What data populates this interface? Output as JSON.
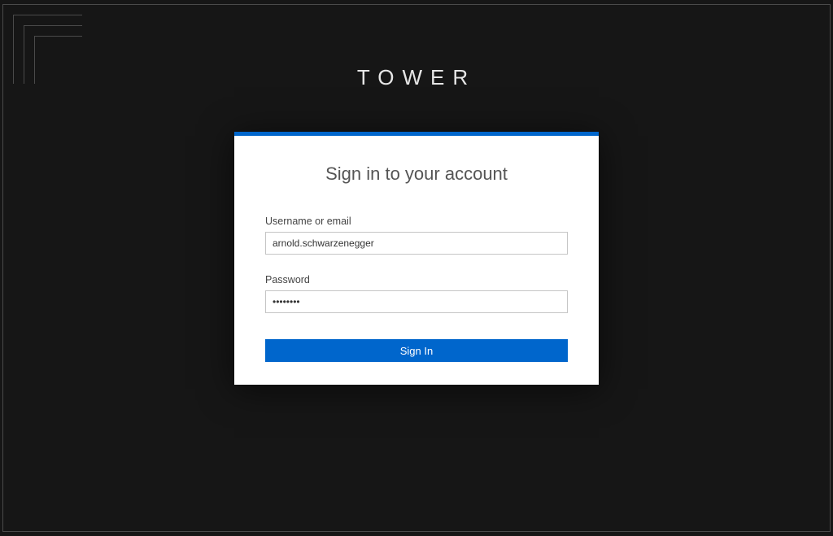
{
  "brand": {
    "title": "TOWER"
  },
  "login": {
    "title": "Sign in to your account",
    "username_label": "Username or email",
    "username_value": "arnold.schwarzenegger",
    "password_label": "Password",
    "password_value": "••••••••",
    "button_label": "Sign In"
  },
  "colors": {
    "background": "#161616",
    "accent": "#0066cc",
    "card": "#ffffff"
  }
}
